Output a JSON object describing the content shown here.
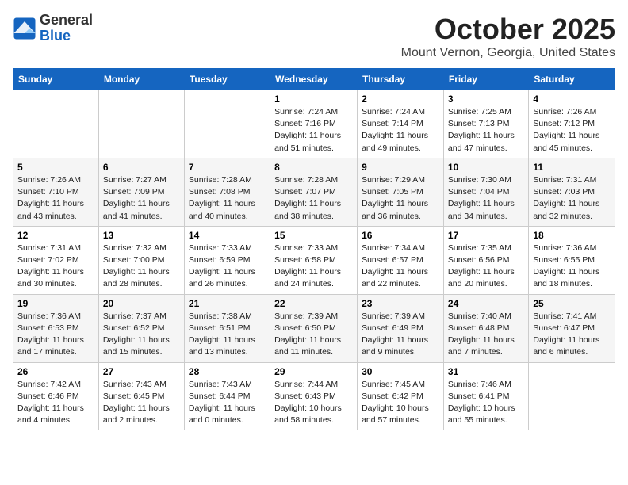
{
  "header": {
    "logo_general": "General",
    "logo_blue": "Blue",
    "month": "October 2025",
    "location": "Mount Vernon, Georgia, United States"
  },
  "days_of_week": [
    "Sunday",
    "Monday",
    "Tuesday",
    "Wednesday",
    "Thursday",
    "Friday",
    "Saturday"
  ],
  "weeks": [
    [
      {
        "day": "",
        "info": ""
      },
      {
        "day": "",
        "info": ""
      },
      {
        "day": "",
        "info": ""
      },
      {
        "day": "1",
        "info": "Sunrise: 7:24 AM\nSunset: 7:16 PM\nDaylight: 11 hours\nand 51 minutes."
      },
      {
        "day": "2",
        "info": "Sunrise: 7:24 AM\nSunset: 7:14 PM\nDaylight: 11 hours\nand 49 minutes."
      },
      {
        "day": "3",
        "info": "Sunrise: 7:25 AM\nSunset: 7:13 PM\nDaylight: 11 hours\nand 47 minutes."
      },
      {
        "day": "4",
        "info": "Sunrise: 7:26 AM\nSunset: 7:12 PM\nDaylight: 11 hours\nand 45 minutes."
      }
    ],
    [
      {
        "day": "5",
        "info": "Sunrise: 7:26 AM\nSunset: 7:10 PM\nDaylight: 11 hours\nand 43 minutes."
      },
      {
        "day": "6",
        "info": "Sunrise: 7:27 AM\nSunset: 7:09 PM\nDaylight: 11 hours\nand 41 minutes."
      },
      {
        "day": "7",
        "info": "Sunrise: 7:28 AM\nSunset: 7:08 PM\nDaylight: 11 hours\nand 40 minutes."
      },
      {
        "day": "8",
        "info": "Sunrise: 7:28 AM\nSunset: 7:07 PM\nDaylight: 11 hours\nand 38 minutes."
      },
      {
        "day": "9",
        "info": "Sunrise: 7:29 AM\nSunset: 7:05 PM\nDaylight: 11 hours\nand 36 minutes."
      },
      {
        "day": "10",
        "info": "Sunrise: 7:30 AM\nSunset: 7:04 PM\nDaylight: 11 hours\nand 34 minutes."
      },
      {
        "day": "11",
        "info": "Sunrise: 7:31 AM\nSunset: 7:03 PM\nDaylight: 11 hours\nand 32 minutes."
      }
    ],
    [
      {
        "day": "12",
        "info": "Sunrise: 7:31 AM\nSunset: 7:02 PM\nDaylight: 11 hours\nand 30 minutes."
      },
      {
        "day": "13",
        "info": "Sunrise: 7:32 AM\nSunset: 7:00 PM\nDaylight: 11 hours\nand 28 minutes."
      },
      {
        "day": "14",
        "info": "Sunrise: 7:33 AM\nSunset: 6:59 PM\nDaylight: 11 hours\nand 26 minutes."
      },
      {
        "day": "15",
        "info": "Sunrise: 7:33 AM\nSunset: 6:58 PM\nDaylight: 11 hours\nand 24 minutes."
      },
      {
        "day": "16",
        "info": "Sunrise: 7:34 AM\nSunset: 6:57 PM\nDaylight: 11 hours\nand 22 minutes."
      },
      {
        "day": "17",
        "info": "Sunrise: 7:35 AM\nSunset: 6:56 PM\nDaylight: 11 hours\nand 20 minutes."
      },
      {
        "day": "18",
        "info": "Sunrise: 7:36 AM\nSunset: 6:55 PM\nDaylight: 11 hours\nand 18 minutes."
      }
    ],
    [
      {
        "day": "19",
        "info": "Sunrise: 7:36 AM\nSunset: 6:53 PM\nDaylight: 11 hours\nand 17 minutes."
      },
      {
        "day": "20",
        "info": "Sunrise: 7:37 AM\nSunset: 6:52 PM\nDaylight: 11 hours\nand 15 minutes."
      },
      {
        "day": "21",
        "info": "Sunrise: 7:38 AM\nSunset: 6:51 PM\nDaylight: 11 hours\nand 13 minutes."
      },
      {
        "day": "22",
        "info": "Sunrise: 7:39 AM\nSunset: 6:50 PM\nDaylight: 11 hours\nand 11 minutes."
      },
      {
        "day": "23",
        "info": "Sunrise: 7:39 AM\nSunset: 6:49 PM\nDaylight: 11 hours\nand 9 minutes."
      },
      {
        "day": "24",
        "info": "Sunrise: 7:40 AM\nSunset: 6:48 PM\nDaylight: 11 hours\nand 7 minutes."
      },
      {
        "day": "25",
        "info": "Sunrise: 7:41 AM\nSunset: 6:47 PM\nDaylight: 11 hours\nand 6 minutes."
      }
    ],
    [
      {
        "day": "26",
        "info": "Sunrise: 7:42 AM\nSunset: 6:46 PM\nDaylight: 11 hours\nand 4 minutes."
      },
      {
        "day": "27",
        "info": "Sunrise: 7:43 AM\nSunset: 6:45 PM\nDaylight: 11 hours\nand 2 minutes."
      },
      {
        "day": "28",
        "info": "Sunrise: 7:43 AM\nSunset: 6:44 PM\nDaylight: 11 hours\nand 0 minutes."
      },
      {
        "day": "29",
        "info": "Sunrise: 7:44 AM\nSunset: 6:43 PM\nDaylight: 10 hours\nand 58 minutes."
      },
      {
        "day": "30",
        "info": "Sunrise: 7:45 AM\nSunset: 6:42 PM\nDaylight: 10 hours\nand 57 minutes."
      },
      {
        "day": "31",
        "info": "Sunrise: 7:46 AM\nSunset: 6:41 PM\nDaylight: 10 hours\nand 55 minutes."
      },
      {
        "day": "",
        "info": ""
      }
    ]
  ]
}
